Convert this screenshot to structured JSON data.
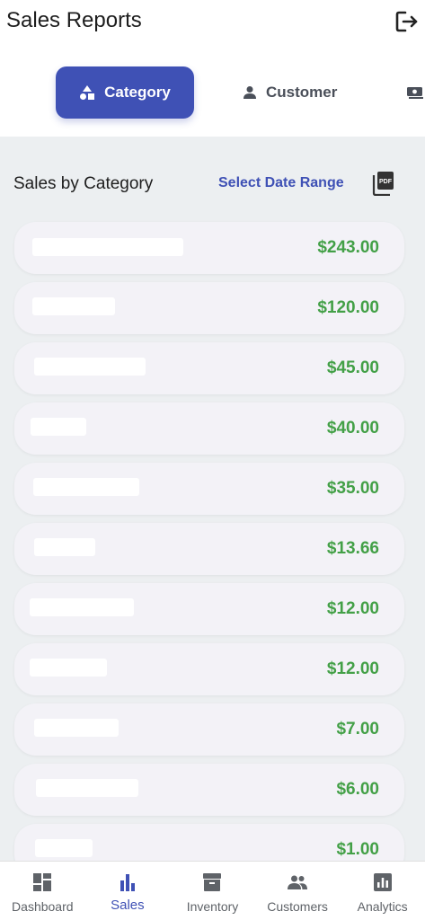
{
  "header": {
    "title": "Sales Reports"
  },
  "tabs": [
    {
      "label": "Category",
      "icon": "shapes-icon"
    },
    {
      "label": "Customer",
      "icon": "person-icon"
    },
    {
      "label": "",
      "icon": "cash-icon"
    }
  ],
  "section": {
    "title": "Sales by Category",
    "date_range_label": "Select Date Range",
    "pdf_label": "PDF"
  },
  "rows": [
    {
      "name": "",
      "amount": "$243.00"
    },
    {
      "name": "",
      "amount": "$120.00"
    },
    {
      "name": "",
      "amount": "$45.00"
    },
    {
      "name": "",
      "amount": "$40.00"
    },
    {
      "name": "",
      "amount": "$35.00"
    },
    {
      "name": "",
      "amount": "$13.66"
    },
    {
      "name": "",
      "amount": "$12.00"
    },
    {
      "name": "",
      "amount": "$12.00"
    },
    {
      "name": "",
      "amount": "$7.00"
    },
    {
      "name": "",
      "amount": "$6.00"
    },
    {
      "name": "",
      "amount": "$1.00"
    }
  ],
  "nav": [
    {
      "label": "Dashboard",
      "icon": "dashboard-icon"
    },
    {
      "label": "Sales",
      "icon": "bar-chart-icon"
    },
    {
      "label": "Inventory",
      "icon": "archive-icon"
    },
    {
      "label": "Customers",
      "icon": "people-icon"
    },
    {
      "label": "Analytics",
      "icon": "analytics-icon"
    }
  ],
  "colors": {
    "primary": "#3f51b5",
    "amount": "#43a047",
    "background": "#eceff1",
    "card": "#f3f2f7"
  }
}
